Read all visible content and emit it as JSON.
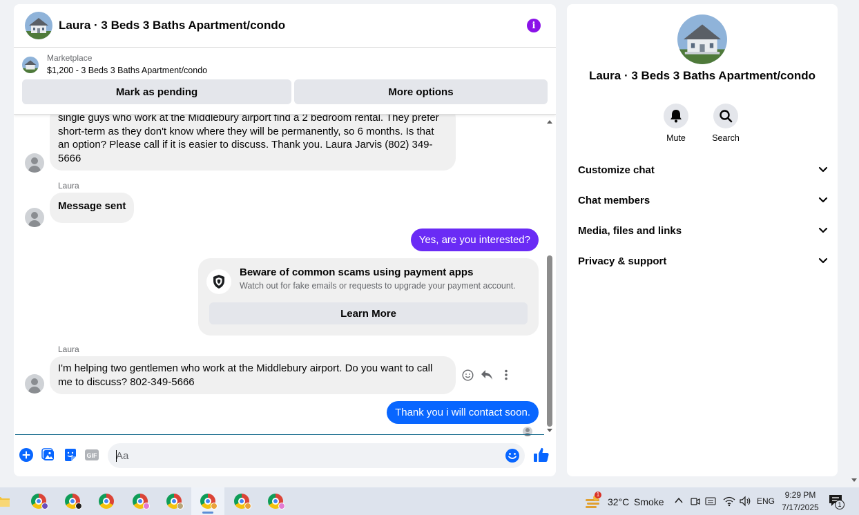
{
  "chat": {
    "title": "Laura · 3 Beds 3 Baths Apartment/condo",
    "marketplace": {
      "label": "Marketplace",
      "listing": "$1,200 - 3 Beds 3 Baths Apartment/condo",
      "mark_pending": "Mark as pending",
      "more_options": "More options"
    },
    "messages": {
      "first_partial_lines": [
        "single guys who work at the Middlebury airport find a 2 bedroom rental.  They prefer",
        "short-term as they don't know where they will be permanently, so 6 months.  Is that",
        "an option?  Please call if it is easier to discuss.  Thank you.  Laura Jarvis (802) 349-",
        "5666"
      ],
      "sender_1": "Laura",
      "message_sent": "Message sent",
      "out_1": "Yes, are you interested?",
      "scam_title": "Beware of common scams using payment apps",
      "scam_sub": "Watch out for fake emails or requests to upgrade your payment account.",
      "learn_more": "Learn More",
      "sender_2": "Laura",
      "in_2_lines": [
        "I'm helping two gentlemen who work at the Middlebury airport.  Do you want to call",
        "me to discuss?  802-349-5666"
      ],
      "out_2": "Thank you i will contact soon."
    },
    "composer": {
      "placeholder": "Aa",
      "value": ""
    },
    "colors": {
      "accent": "#0866ff",
      "outgoing_bubble": "#6a2bf5",
      "info_icon": "#8a12e8"
    }
  },
  "info_panel": {
    "title": "Laura · 3 Beds 3 Baths Apartment/condo",
    "actions": [
      "Mute",
      "Search"
    ],
    "sections": [
      "Customize chat",
      "Chat members",
      "Media, files and links",
      "Privacy & support"
    ]
  },
  "taskbar": {
    "weather_temp": "32°C",
    "weather_desc": "Smoke",
    "weather_badge": "1",
    "language": "ENG",
    "time": "9:29 PM",
    "date": "7/17/2025",
    "notification_count": "1"
  }
}
